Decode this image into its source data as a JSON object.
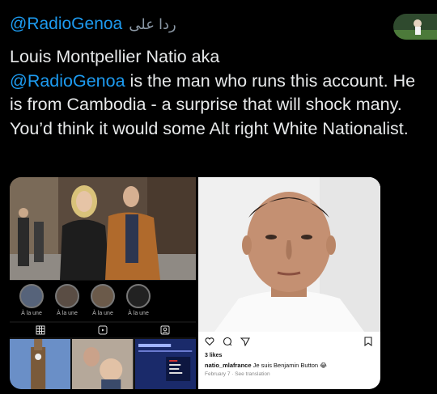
{
  "reply": {
    "handle": "@RadioGenoa",
    "prefix_arabic": "ردا على"
  },
  "tweet": {
    "line_pre_name": "Louis Montpellier Natio aka",
    "mention": "@RadioGenoa",
    "line_after_mention": " is the man who runs this account. He is from Cambodia - a surprise that will shock many. You’d think it would some Alt right White Nationalist."
  },
  "instagram_profile": {
    "highlight_label": "À la une",
    "highlights": [
      "À la une",
      "À la une",
      "À la une",
      "À la une"
    ]
  },
  "instagram_post": {
    "likes": "3 likes",
    "username": "natio_mlafrance",
    "caption": "Je suis Benjamin Button",
    "date": "February 7",
    "see_translation": "See translation"
  }
}
